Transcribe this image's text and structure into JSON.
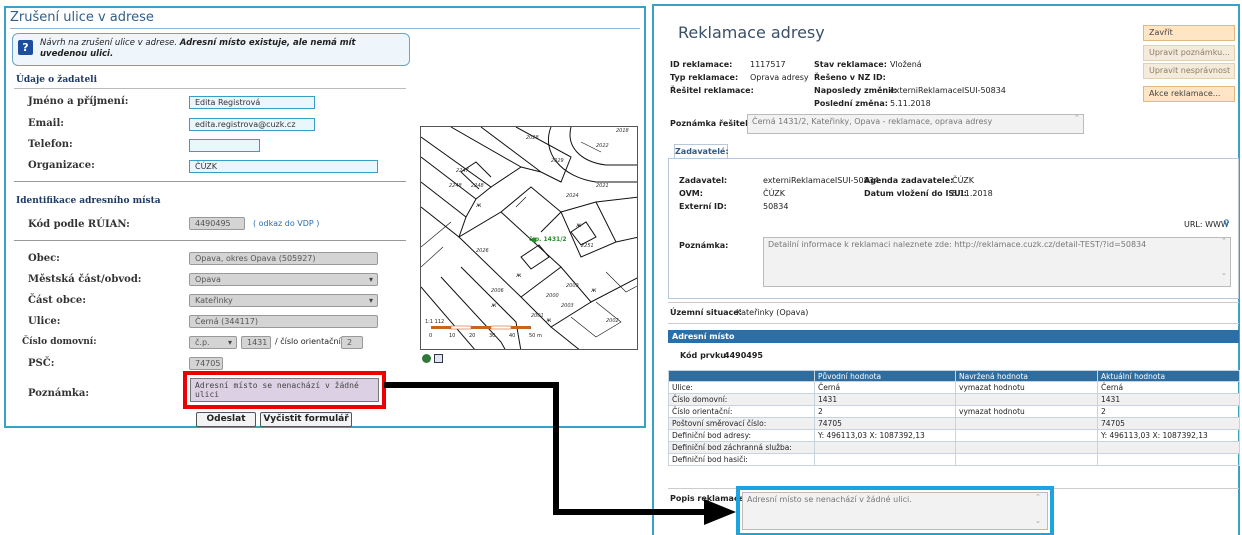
{
  "left": {
    "title": "Zrušení ulice v adrese",
    "info_text": "Návrh na zrušení ulice v adrese. ",
    "info_bold": "Adresní místo existuje, ale nemá mít uvedenou ulici.",
    "section_applicant": "Údaje o žadateli",
    "fields": {
      "name_label": "Jméno a příjmení:",
      "name_value": "Edita Registrová",
      "email_label": "Email:",
      "email_value": "edita.registrova@cuzk.cz",
      "phone_label": "Telefon:",
      "phone_value": "",
      "org_label": "Organizace:",
      "org_value": "ČÚZK"
    },
    "section_place": "Identifikace adresního místa",
    "ruian_label": "Kód podle RÚIAN:",
    "ruian_value": "4490495",
    "vdp_link": "( odkaz do VDP )",
    "obec_label": "Obec:",
    "obec_value": "Opava, okres Opava (505927)",
    "mestska_label": "Městská část/obvod:",
    "mestska_value": "Opava",
    "cast_label": "Část obce:",
    "cast_value": "Kateřinky",
    "ulice_label": "Ulice:",
    "ulice_value": "Černá (344117)",
    "cislo_label": "Číslo domovní:",
    "cislo_type": "č.p.",
    "cislo_value": "1431",
    "orient_label": "/ číslo orientační:",
    "orient_value": "2",
    "psc_label": "PSČ:",
    "psc_value": "74705",
    "poznamka_label": "Poznámka:",
    "poznamka_value": "Adresní místo se nenachází v žádné ulici",
    "send_btn": "Odeslat",
    "clear_btn": "Vyčistit formulář"
  },
  "map": {
    "scale_text": "1:1 112",
    "scale_ticks": [
      "0",
      "10",
      "20",
      "30",
      "40",
      "50 m"
    ],
    "address_label": "č.p. 1431/2",
    "parcels": [
      "2028",
      "2029",
      "2022",
      "2247",
      "2248",
      "2024",
      "2021",
      "2251",
      "2026",
      "2018",
      "2006",
      "2009",
      "2001",
      "2002",
      "2003",
      "2000",
      "2248"
    ]
  },
  "right": {
    "title": "Reklamace adresy",
    "buttons": {
      "close": "Zavřít",
      "edit_note": "Upravit poznámku...",
      "edit_inaccuracy": "Upravit nesprávnost",
      "actions": "Akce reklamace..."
    },
    "id_label": "ID reklamace:",
    "id_value": "1117517",
    "type_label": "Typ reklamace:",
    "type_value": "Oprava adresy",
    "solver_label": "Řešitel reklamace:",
    "state_label": "Stav reklamace:",
    "state_value": "Vložená",
    "nz_label": "Řešeno v NZ ID:",
    "lastby_label": "Naposledy změnil:",
    "lastby_value": "externiReklamaceISUI-50834",
    "lastchange_label": "Poslední změna:",
    "lastchange_value": "5.11.2018",
    "solver_note_label": "Poznámka řešitele:",
    "solver_note_value": "Černá 1431/2, Kateřinky, Opava - reklamace, oprava adresy",
    "tab_label": "Zadavatelé:",
    "submitter_label": "Zadavatel:",
    "submitter_value": "externiReklamaceISUI-50834",
    "agenda_label": "Agenda zadavatele:",
    "agenda_value": "ČÚZK",
    "ovm_label": "OVM:",
    "ovm_value": "ČÚZK",
    "date_label": "Datum vložení do ISUI:",
    "date_value": "5.11.2018",
    "extid_label": "Externí ID:",
    "extid_value": "50834",
    "url_label": "URL: WWW",
    "note_label": "Poznámka:",
    "note_value": "Detailní informace k reklamaci naleznete zde: http://reklamace.cuzk.cz/detail-TEST/?id=50834",
    "territory_label": "Územní situace:",
    "territory_value": "Kateřinky (Opava)",
    "address_bar": "Adresní místo",
    "code_label": "Kód prvku:",
    "code_value": "4490495",
    "table": {
      "headers": [
        "",
        "Původní hodnota",
        "Navržená hodnota",
        "Aktuální hodnota"
      ],
      "rows": [
        [
          "Ulice:",
          "Černá",
          "vymazat hodnotu",
          "Černá"
        ],
        [
          "Číslo domovní:",
          "1431",
          "",
          "1431"
        ],
        [
          "Číslo orientační:",
          "2",
          "vymazat hodnotu",
          "2"
        ],
        [
          "Poštovní směrovací číslo:",
          "74705",
          "",
          "74705"
        ],
        [
          "Definiční bod adresy:",
          "Y: 496113,03 X: 1087392,13",
          "",
          "Y: 496113,03 X: 1087392,13"
        ],
        [
          "Definiční bod záchranná služba:",
          "",
          "",
          ""
        ],
        [
          "Definiční bod hasiči:",
          "",
          "",
          ""
        ]
      ]
    },
    "desc_label": "Popis reklamace:",
    "desc_value": "Adresní místo se nenachází v žádné ulici."
  },
  "colors": {
    "panel_border": "#3aa0c8",
    "highlight_red": "#e00000",
    "highlight_blue": "#1aa4e0",
    "header_blue": "#2b6fa8",
    "action_orange": "#fde5c6"
  }
}
